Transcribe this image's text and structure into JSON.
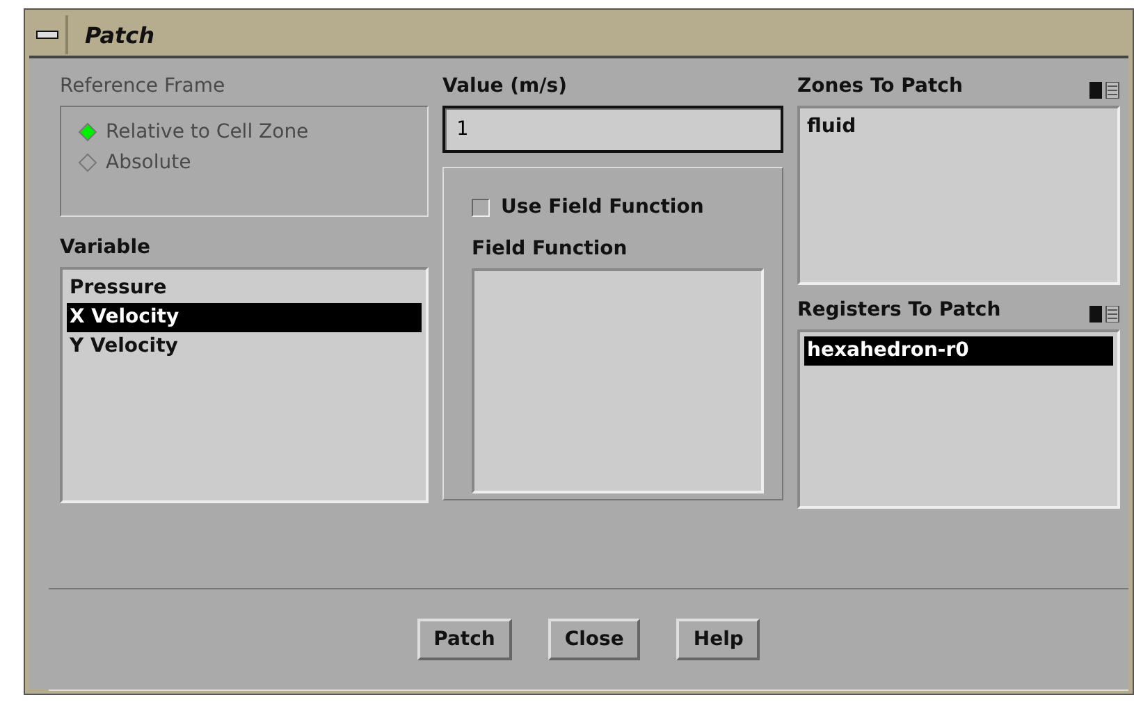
{
  "window": {
    "title": "Patch"
  },
  "reference_frame": {
    "label": "Reference Frame",
    "disabled": true,
    "options": [
      {
        "label": "Relative to Cell Zone",
        "selected": true
      },
      {
        "label": "Absolute",
        "selected": false
      }
    ]
  },
  "variable": {
    "label": "Variable",
    "items": [
      {
        "label": "Pressure",
        "selected": false
      },
      {
        "label": "X Velocity",
        "selected": true
      },
      {
        "label": "Y Velocity",
        "selected": false
      }
    ]
  },
  "value": {
    "label": "Value (m/s)",
    "value": "1"
  },
  "field_function": {
    "checkbox_label": "Use Field Function",
    "checked": false,
    "label": "Field Function"
  },
  "zones": {
    "label": "Zones To Patch",
    "items": [
      {
        "label": "fluid",
        "selected": false
      }
    ]
  },
  "registers": {
    "label": "Registers To Patch",
    "items": [
      {
        "label": "hexahedron-r0",
        "selected": true
      }
    ]
  },
  "buttons": [
    "Patch",
    "Close",
    "Help"
  ]
}
